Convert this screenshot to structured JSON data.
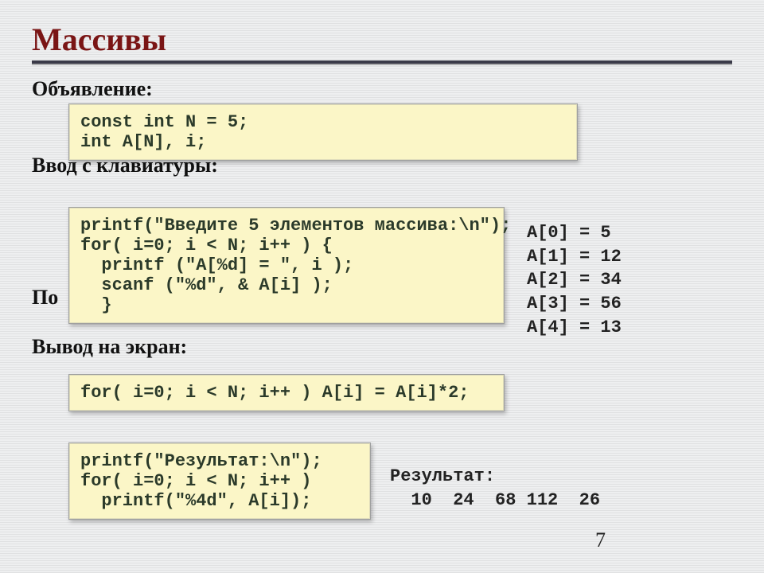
{
  "title": "Массивы",
  "labels": {
    "declare": "Объявление:",
    "input": "Ввод с клавиатуры:",
    "partial": "По",
    "output": "Вывод на экран:"
  },
  "code": {
    "declare": "const int N = 5;\nint A[N], i;",
    "read": "printf(\"Введите 5 элементов массива:\\n\");\nfor( i=0; i < N; i++ ) {\n  printf (\"A[%d] = \", i );\n  scanf (\"%d\", & A[i] );\n  }",
    "transform": "for( i=0; i < N; i++ ) A[i] = A[i]*2;",
    "print": "printf(\"Результат:\\n\");\nfor( i=0; i < N; i++ )\n  printf(\"%4d\", A[i]);"
  },
  "sample_input": "A[0] = 5\nA[1] = 12\nA[2] = 34\nA[3] = 56\nA[4] = 13",
  "result": {
    "label": "Результат:",
    "values": "  10  24  68 112  26"
  },
  "page_number": "7"
}
